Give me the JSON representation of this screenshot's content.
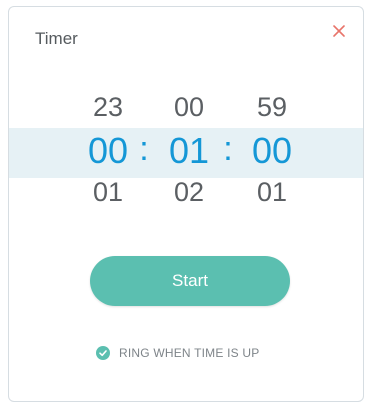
{
  "dialog": {
    "title": "Timer",
    "close_icon": "close-icon"
  },
  "picker": {
    "hours": {
      "above": "23",
      "selected": "00",
      "below": "01"
    },
    "minutes": {
      "above": "00",
      "selected": "01",
      "below": "02"
    },
    "seconds": {
      "above": "59",
      "selected": "00",
      "below": "01"
    },
    "separator": ":"
  },
  "actions": {
    "start_label": "Start"
  },
  "options": {
    "ring_label": "RING WHEN TIME IS UP",
    "ring_checked": true,
    "check_icon": "check-icon"
  },
  "colors": {
    "accent": "#5bbfb0",
    "selected_digit": "#1497d6",
    "close": "#e8746a",
    "band": "#e6f1f5"
  }
}
